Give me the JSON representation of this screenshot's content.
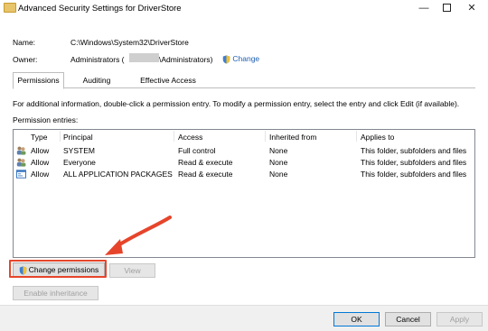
{
  "window": {
    "title": "Advanced Security Settings for DriverStore",
    "minimize_glyph": "—",
    "close_glyph": "✕"
  },
  "header": {
    "name_label": "Name:",
    "name_value": "C:\\Windows\\System32\\DriverStore",
    "owner_label": "Owner:",
    "owner_value_prefix": "Administrators (",
    "owner_value_suffix": "\\Administrators)",
    "change_link": "Change"
  },
  "tabs": [
    {
      "label": "Permissions",
      "active": true
    },
    {
      "label": "Auditing",
      "active": false
    },
    {
      "label": "Effective Access",
      "active": false
    }
  ],
  "info_text": "For additional information, double-click a permission entry. To modify a permission entry, select the entry and click Edit (if available).",
  "entries_label": "Permission entries:",
  "columns": [
    "Type",
    "Principal",
    "Access",
    "Inherited from",
    "Applies to"
  ],
  "entries": [
    {
      "type": "Allow",
      "principal": "SYSTEM",
      "access": "Full control",
      "inherited": "None",
      "applies": "This folder, subfolders and files",
      "icon": "user-group-icon"
    },
    {
      "type": "Allow",
      "principal": "Everyone",
      "access": "Read & execute",
      "inherited": "None",
      "applies": "This folder, subfolders and files",
      "icon": "user-group-icon"
    },
    {
      "type": "Allow",
      "principal": "ALL APPLICATION PACKAGES",
      "access": "Read & execute",
      "inherited": "None",
      "applies": "This folder, subfolders and files",
      "icon": "app-package-icon"
    }
  ],
  "buttons": {
    "change_permissions": "Change permissions",
    "view": "View",
    "enable_inheritance": "Enable inheritance",
    "ok": "OK",
    "cancel": "Cancel",
    "apply": "Apply"
  },
  "colors": {
    "annotation_red": "#e6452b",
    "link_blue": "#1c5fb0",
    "primary_border": "#0078d7"
  }
}
